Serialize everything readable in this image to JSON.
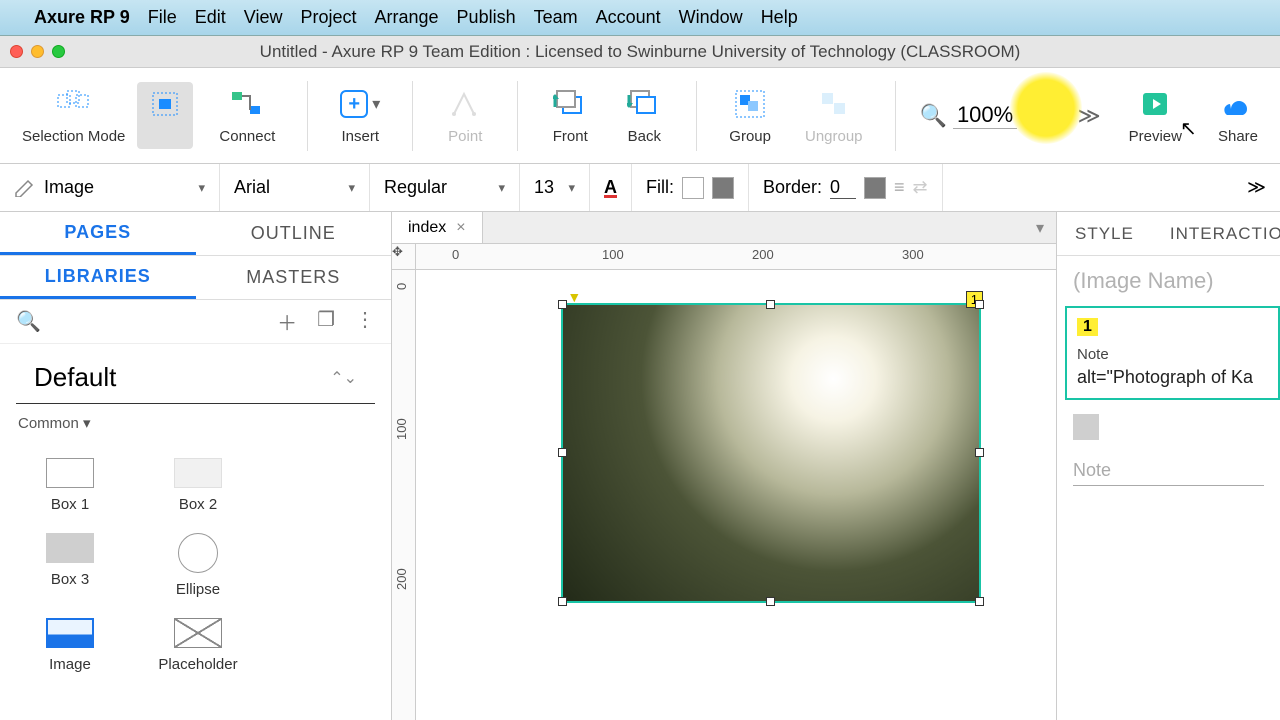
{
  "menubar": {
    "app": "Axure RP 9",
    "items": [
      "File",
      "Edit",
      "View",
      "Project",
      "Arrange",
      "Publish",
      "Team",
      "Account",
      "Window",
      "Help"
    ]
  },
  "window_title": "Untitled - Axure RP 9 Team Edition : Licensed to Swinburne University of Technology (CLASSROOM)",
  "toolbar": {
    "selection_mode": "Selection Mode",
    "connect": "Connect",
    "insert": "Insert",
    "point": "Point",
    "front": "Front",
    "back": "Back",
    "group": "Group",
    "ungroup": "Ungroup",
    "zoom": "100%",
    "preview": "Preview",
    "share": "Share"
  },
  "format": {
    "widget_type": "Image",
    "font_family": "Arial",
    "font_weight": "Regular",
    "font_size": "13",
    "fill_label": "Fill:",
    "border_label": "Border:",
    "border_width": "0"
  },
  "left": {
    "tab_pages": "PAGES",
    "tab_outline": "OUTLINE",
    "tab_libraries": "LIBRARIES",
    "tab_masters": "MASTERS",
    "library_name": "Default",
    "section": "Common ▾",
    "widgets": [
      "Box 1",
      "Box 2",
      "Box 3",
      "Ellipse",
      "Image",
      "Placeholder"
    ]
  },
  "canvas": {
    "open_tab": "index",
    "ruler_marks": [
      "0",
      "100",
      "200",
      "300"
    ],
    "ruler_marks_v": [
      "0",
      "100",
      "200"
    ],
    "note_badge": "1"
  },
  "right": {
    "tab_style": "STYLE",
    "tab_interactions": "INTERACTIO",
    "name_placeholder": "(Image Name)",
    "note_badge": "1",
    "note_label": "Note",
    "note_value": "alt=\"Photograph of Ka",
    "note2_placeholder": "Note"
  }
}
